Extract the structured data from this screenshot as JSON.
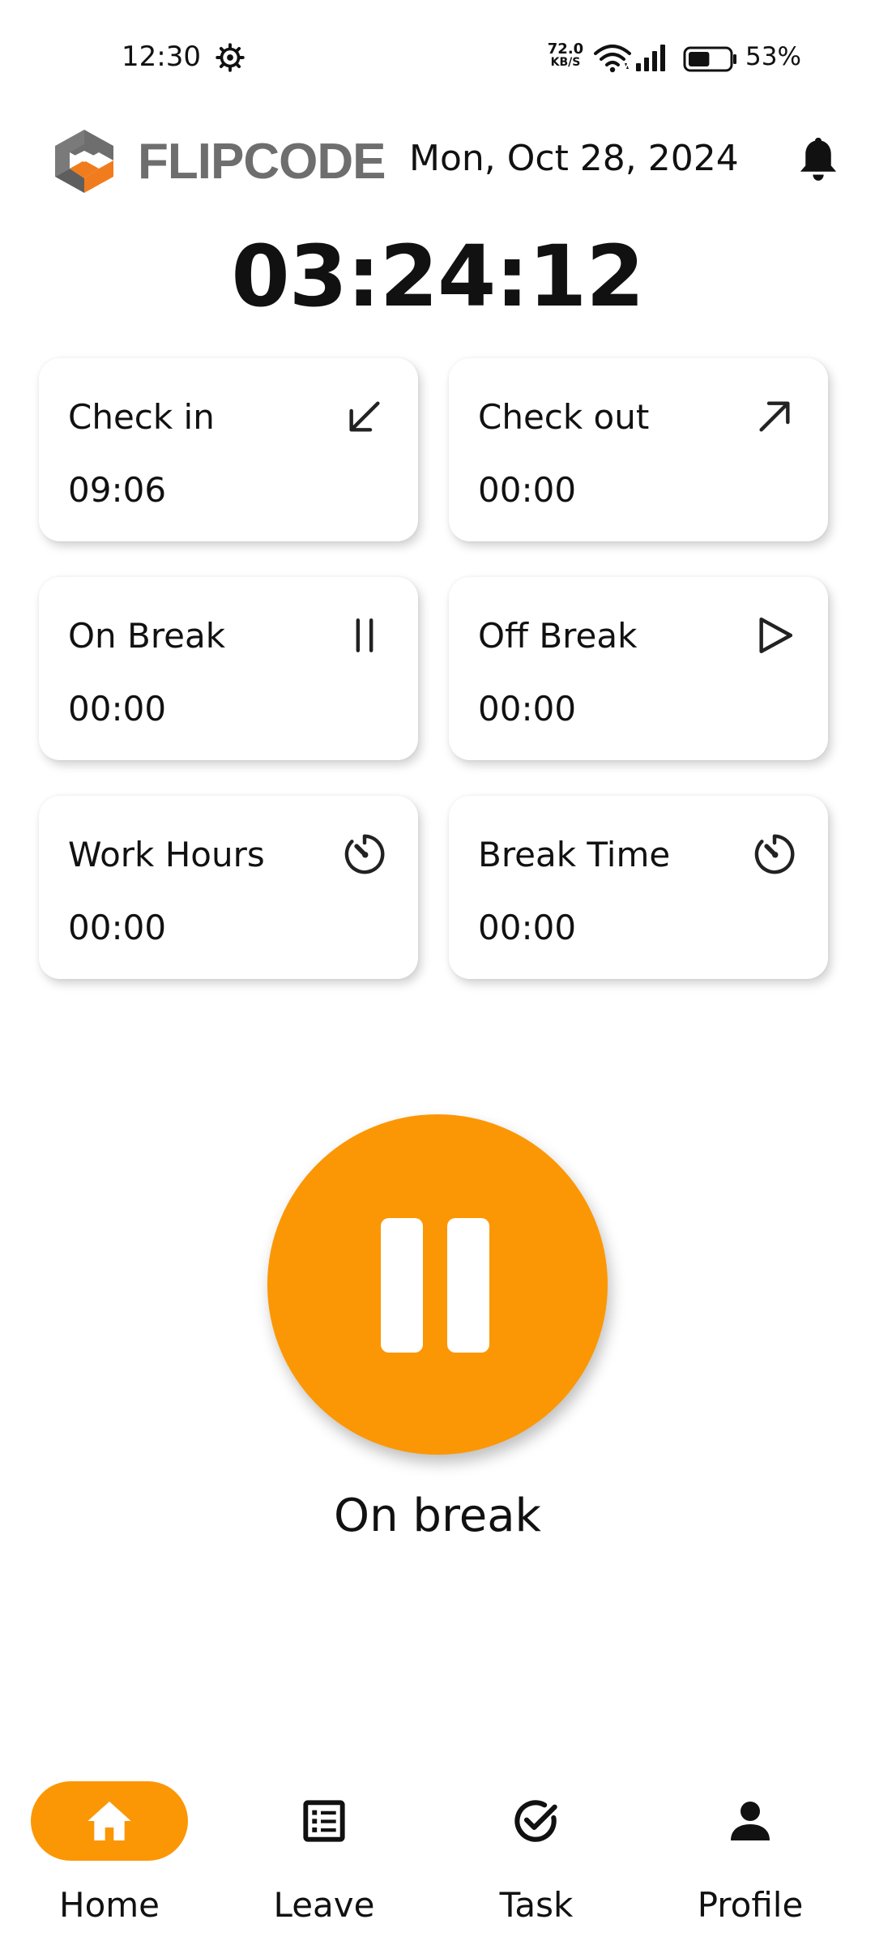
{
  "status_bar": {
    "time": "12:30",
    "net_speed_value": "72.0",
    "net_speed_unit": "KB/S",
    "battery_text": "53%",
    "battery_level": 0.53
  },
  "header": {
    "brand": "FLIPCODE",
    "date": "Mon, Oct 28, 2024",
    "icons": {
      "logo": "flipcode-logo",
      "notifications": "bell-icon"
    }
  },
  "timer": "03:24:12",
  "cards": [
    {
      "label": "Check in",
      "value": "09:06",
      "icon": "arrow-down-left-icon"
    },
    {
      "label": "Check out",
      "value": "00:00",
      "icon": "arrow-up-right-icon"
    },
    {
      "label": "On Break",
      "value": "00:00",
      "icon": "pause-icon"
    },
    {
      "label": "Off Break",
      "value": "00:00",
      "icon": "play-icon"
    },
    {
      "label": "Work Hours",
      "value": "00:00",
      "icon": "timer-icon"
    },
    {
      "label": "Break Time",
      "value": "00:00",
      "icon": "timer-icon"
    }
  ],
  "main_action": {
    "icon": "pause-icon",
    "status": "On break",
    "color": "#fb9704"
  },
  "nav": [
    {
      "label": "Home",
      "icon": "home-icon",
      "active": true
    },
    {
      "label": "Leave",
      "icon": "list-icon",
      "active": false
    },
    {
      "label": "Task",
      "icon": "check-circle-icon",
      "active": false
    },
    {
      "label": "Profile",
      "icon": "person-icon",
      "active": false
    }
  ],
  "colors": {
    "accent": "#fb9704",
    "logo_grey": "#6e6e6e",
    "logo_orange": "#f07c1e"
  }
}
